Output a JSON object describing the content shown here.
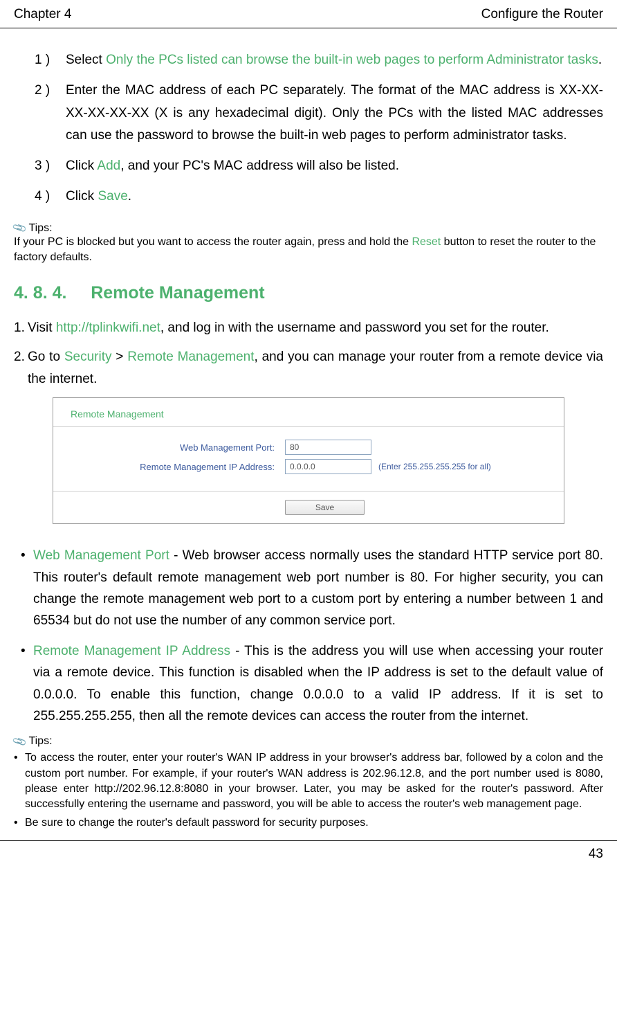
{
  "header": {
    "chapter": "Chapter 4",
    "title": "Configure the Router"
  },
  "steps": {
    "step1": {
      "num": "1 )",
      "pre": "Select ",
      "highlight": "Only the PCs listed can browse the built-in web pages to perform Administrator tasks",
      "post": "."
    },
    "step2": {
      "num": "2 )",
      "text": "Enter the MAC address of each PC separately. The format of the MAC address is XX-XX-XX-XX-XX-XX (X is any hexadecimal digit). Only the PCs with the listed MAC addresses can use the password to browse the built-in web pages to perform administrator tasks."
    },
    "step3": {
      "num": "3 )",
      "pre": "Click ",
      "highlight": "Add",
      "post": ", and your PC's MAC address will also be listed."
    },
    "step4": {
      "num": "4 )",
      "pre": "Click ",
      "highlight": "Save",
      "post": "."
    }
  },
  "tips1": {
    "label": "Tips:",
    "part1": "If your PC is blocked but you want to access the router again, press and hold the ",
    "highlight": "Reset",
    "part2": " button to reset the router to the factory defaults."
  },
  "section": {
    "number": "4. 8. 4.",
    "title": "Remote Management"
  },
  "instructions": {
    "item1": {
      "num": "1. ",
      "pre": "Visit ",
      "link": "http://tplinkwifi.net",
      "post": ", and log in with the username and password you set for the router."
    },
    "item2": {
      "num": "2. ",
      "pre": "Go to ",
      "nav1": "Security",
      "sep": " > ",
      "nav2": "Remote Management",
      "post": ", and you can manage your router from a remote device via the internet."
    }
  },
  "screenshot": {
    "title": "Remote Management",
    "port_label": "Web Management Port:",
    "port_value": "80",
    "ip_label": "Remote Management IP Address:",
    "ip_value": "0.0.0.0",
    "ip_hint": "(Enter 255.255.255.255 for all)",
    "save_button": "Save"
  },
  "descriptions": {
    "item1": {
      "title": "Web Management Port",
      "text": " - Web browser access normally uses the standard HTTP service port 80. This router's default remote management web port number is 80. For higher security, you can change the remote management web port to a custom port by entering a number between 1 and 65534 but do not use the number of any common service port."
    },
    "item2": {
      "title": "Remote Management IP Address",
      "text": " - This is the address you will use when accessing your router via a remote device. This function is disabled when the IP address is set to the default value of 0.0.0.0. To enable this function, change 0.0.0.0 to a valid IP address. If it is set to 255.255.255.255, then all the remote devices can access the router from the internet."
    }
  },
  "tips2": {
    "label": "Tips:",
    "item1": "To access the router, enter your router's WAN IP address in your browser's address bar, followed by a colon and the custom port number. For example, if your router's WAN address is 202.96.12.8, and the port number used is 8080, please enter http://202.96.12.8:8080 in your browser. Later, you may be asked for the router's password. After successfully entering the username and password, you will be able to access the router's web management page.",
    "item2": "Be sure to change the router's default password for security purposes."
  },
  "footer": {
    "page_number": "43"
  }
}
